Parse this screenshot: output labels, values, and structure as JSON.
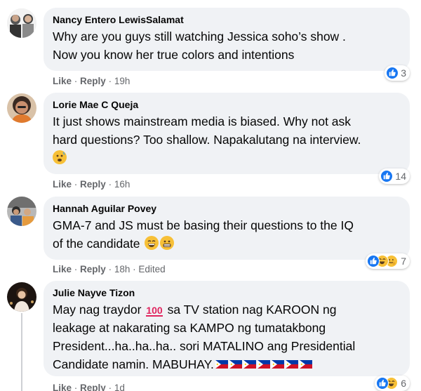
{
  "top_clip": "reply",
  "comments": [
    {
      "author": "Nancy Entero LewisSalamat",
      "lines": [
        "Why are you guys still watching Jessica soho’s show .",
        "Now you know her true colors and intentions"
      ],
      "like_label": "Like",
      "reply_label": "Reply",
      "time": "19h",
      "edited": "",
      "reaction_count": "3",
      "reactions": [
        "like"
      ]
    },
    {
      "author": "Lorie Mae C Queja",
      "lines": [
        "It just shows mainstream media is biased. Why not ask",
        "hard questions? Too shallow. Napakalutang na interview."
      ],
      "like_label": "Like",
      "reply_label": "Reply",
      "time": "16h",
      "edited": "",
      "reaction_count": "14",
      "reactions": [
        "like"
      ],
      "emoji": [
        "cold-sweat-emoji"
      ]
    },
    {
      "author": "Hannah Aguilar Povey",
      "lines": [
        "GMA-7 and JS must be basing their questions to the IQ",
        "of the candidate"
      ],
      "like_label": "Like",
      "reply_label": "Reply",
      "time": "18h",
      "edited": "Edited",
      "reaction_count": "7",
      "reactions": [
        "like",
        "haha",
        "love"
      ],
      "emoji": [
        "grinning-emoji",
        "grimacing-emoji"
      ]
    },
    {
      "author": "Julie Nayve Tizon",
      "lines": [
        "May nag traydor",
        "sa TV station nag KAROON ng",
        "leakage at nakarating sa KAMPO ng tumatakbong",
        "President...ha..ha..ha.. sori MATALINO ang Presidential",
        "Candidate namin. MABUHAY."
      ],
      "like_label": "Like",
      "reply_label": "Reply",
      "time": "1d",
      "edited": "",
      "reaction_count": "6",
      "reactions": [
        "like",
        "haha"
      ],
      "emoji": [
        "hundred-points-emoji",
        "philippine-flag-emoji"
      ]
    }
  ],
  "colors": {
    "bubble": "#f0f2f5",
    "meta": "#65676b",
    "like_blue": "#1877f2",
    "haha_yellow": "#f7c037",
    "love_red": "#f33e58"
  }
}
